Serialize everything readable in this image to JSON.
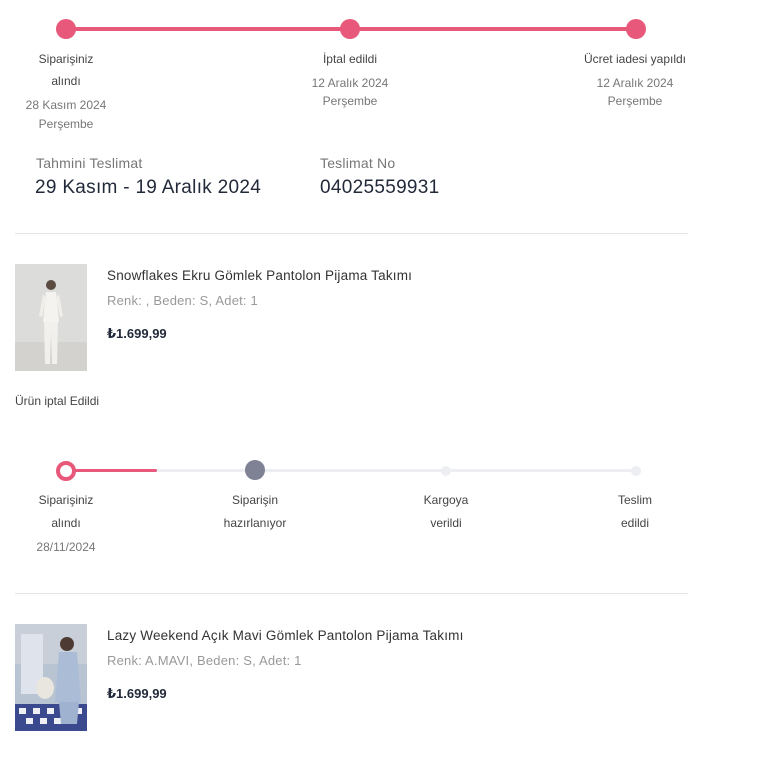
{
  "colors": {
    "accent": "#e8587a",
    "inactive_track": "#eceef2",
    "current_dot": "#7f8194",
    "text_dark": "#222a3a"
  },
  "refund_progress": {
    "steps": [
      {
        "label_line1": "Siparişiniz",
        "label_line2": "alındı",
        "date": "28 Kasım 2024",
        "day": "Perşembe"
      },
      {
        "label_line1": "İptal edildi",
        "date": "12 Aralık 2024",
        "day": "Perşembe"
      },
      {
        "label_line1": "Ücret iadesi yapıldı",
        "date": "12 Aralık 2024",
        "day": "Perşembe"
      }
    ]
  },
  "delivery": {
    "estimated_label": "Tahmini Teslimat",
    "estimated_value": "29 Kasım - 19 Aralık 2024",
    "tracking_label": "Teslimat No",
    "tracking_value": "04025559931"
  },
  "products": [
    {
      "name": "Snowflakes Ekru Gömlek Pantolon Pijama Takımı",
      "meta": "Renk: , Beden: S, Adet: 1",
      "price": "₺1.699,99",
      "status": "Ürün iptal Edildi"
    },
    {
      "name": "Lazy Weekend Açık Mavi Gömlek Pantolon Pijama Takımı",
      "meta": "Renk: A.MAVI, Beden: S, Adet: 1",
      "price": "₺1.699,99"
    }
  ],
  "shipment_progress": {
    "steps": [
      {
        "line1": "Siparişiniz",
        "line2": "alındı",
        "date": "28/11/2024"
      },
      {
        "line1": "Siparişin",
        "line2": "hazırlanıyor"
      },
      {
        "line1": "Kargoya",
        "line2": "verildi"
      },
      {
        "line1": "Teslim",
        "line2": "edildi"
      }
    ],
    "progress_fraction": 0.16
  }
}
